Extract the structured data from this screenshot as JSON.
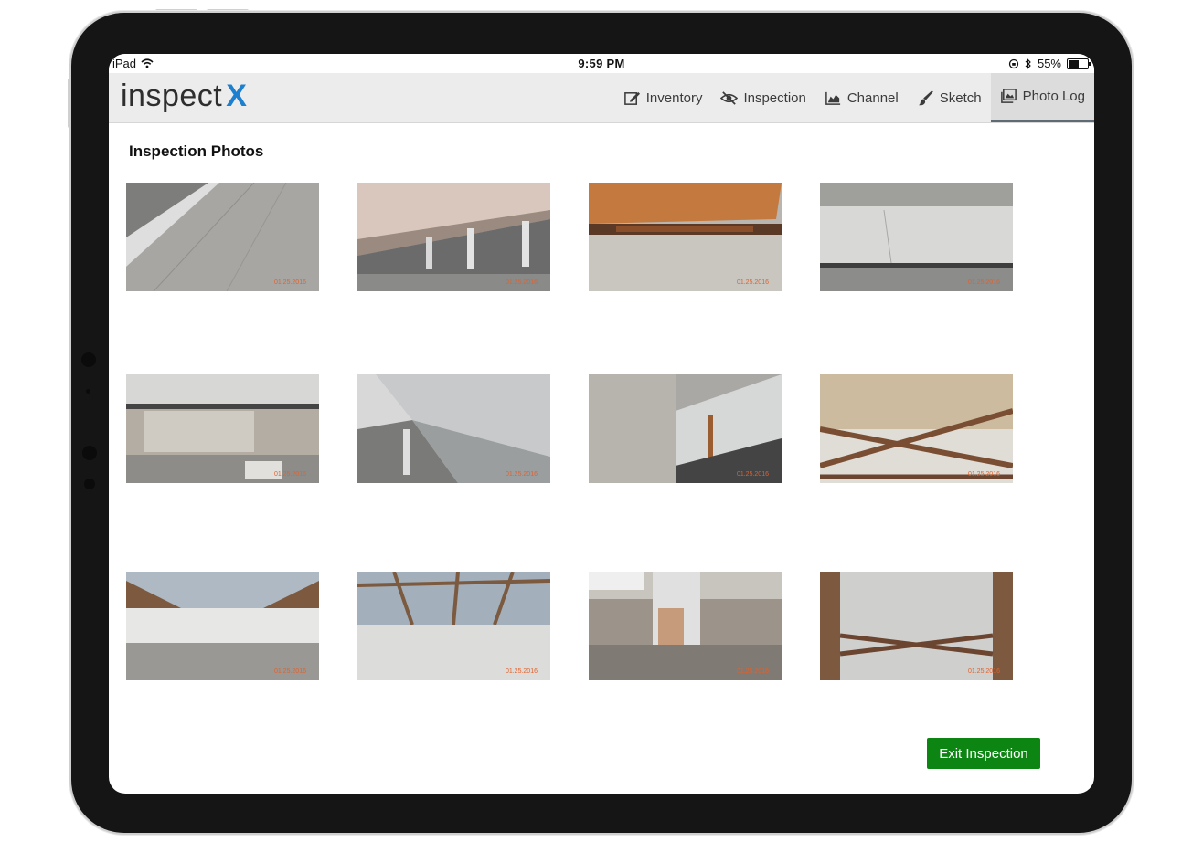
{
  "status_bar": {
    "device": "iPad",
    "time": "9:59 PM",
    "battery": "55%",
    "battery_level": 0.55
  },
  "app": {
    "logo_text": "inspect",
    "logo_mark": "X",
    "brand_color": "#1c7fd0"
  },
  "nav": {
    "items": [
      {
        "label": "Inventory",
        "icon": "edit-icon"
      },
      {
        "label": "Inspection",
        "icon": "eye-slash-icon"
      },
      {
        "label": "Channel",
        "icon": "area-chart-icon"
      },
      {
        "label": "Sketch",
        "icon": "brush-icon"
      },
      {
        "label": "Photo Log",
        "icon": "photo-album-icon",
        "active": true
      }
    ]
  },
  "page": {
    "title": "Inspection Photos"
  },
  "photos": [
    {
      "scene": "deck surface",
      "date": "01.25.2016"
    },
    {
      "scene": "girder underside",
      "date": "01.25.2016"
    },
    {
      "scene": "rusted bearing",
      "date": "01.25.2016"
    },
    {
      "scene": "abutment wall",
      "date": "01.25.2016"
    },
    {
      "scene": "spalled abutment",
      "date": "01.25.2016"
    },
    {
      "scene": "girder with piers",
      "date": "01.25.2016"
    },
    {
      "scene": "girder seat",
      "date": "01.25.2016"
    },
    {
      "scene": "cross bracing",
      "date": "01.25.2016"
    },
    {
      "scene": "underside bays",
      "date": "01.25.2016"
    },
    {
      "scene": "bracing framework",
      "date": "01.25.2016"
    },
    {
      "scene": "pier column",
      "date": "01.25.2016"
    },
    {
      "scene": "diaphragm bracing",
      "date": "01.25.2016"
    }
  ],
  "actions": {
    "exit_label": "Exit Inspection",
    "exit_color": "#0d8512"
  }
}
